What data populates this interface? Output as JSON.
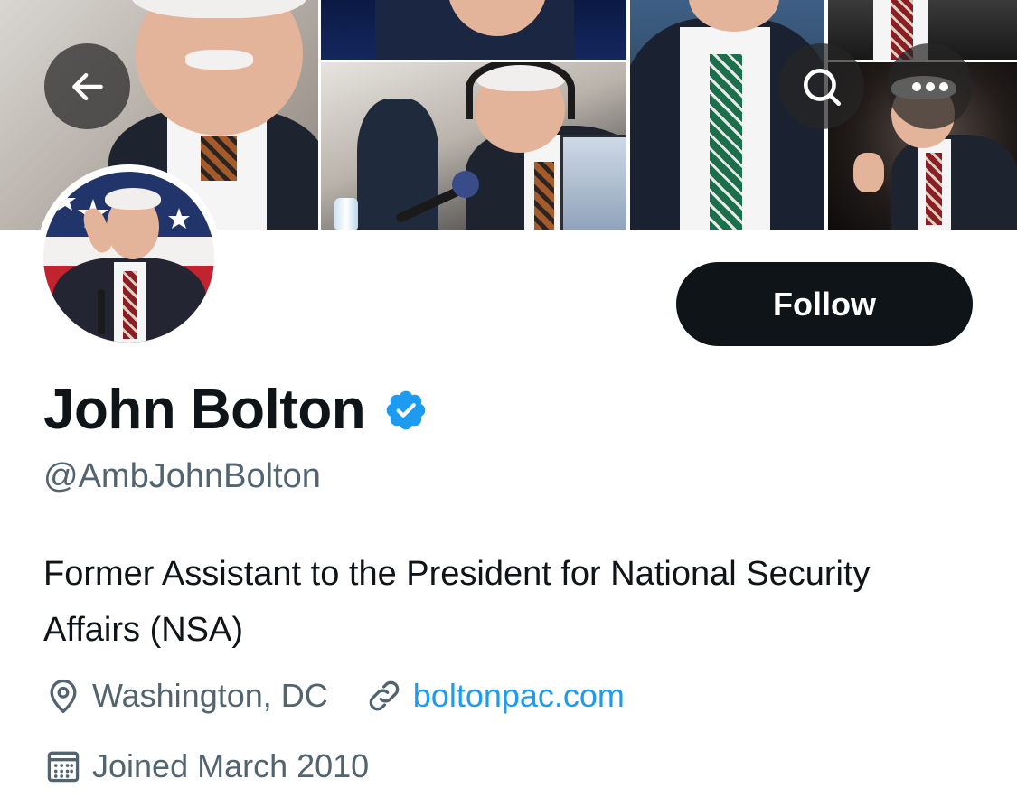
{
  "header": {
    "back_label": "Back",
    "search_label": "Search",
    "more_label": "More"
  },
  "profile": {
    "display_name": "John Bolton",
    "verified": true,
    "handle": "@AmbJohnBolton",
    "bio": "Former Assistant to the President for National Security Affairs (NSA)",
    "location": "Washington, DC",
    "website": "boltonpac.com",
    "joined": "Joined March 2010"
  },
  "actions": {
    "follow_label": "Follow"
  },
  "icons": {
    "back": "arrow-left-icon",
    "search": "search-icon",
    "more": "more-horizontal-icon",
    "verified": "verified-badge-icon",
    "location": "location-pin-icon",
    "link": "link-icon",
    "calendar": "calendar-icon"
  },
  "colors": {
    "verified_blue": "#1d9bf0",
    "link_blue": "#1d9bf0",
    "secondary_text": "#536471",
    "primary_text": "#0f1419",
    "follow_bg": "#0f1419"
  }
}
